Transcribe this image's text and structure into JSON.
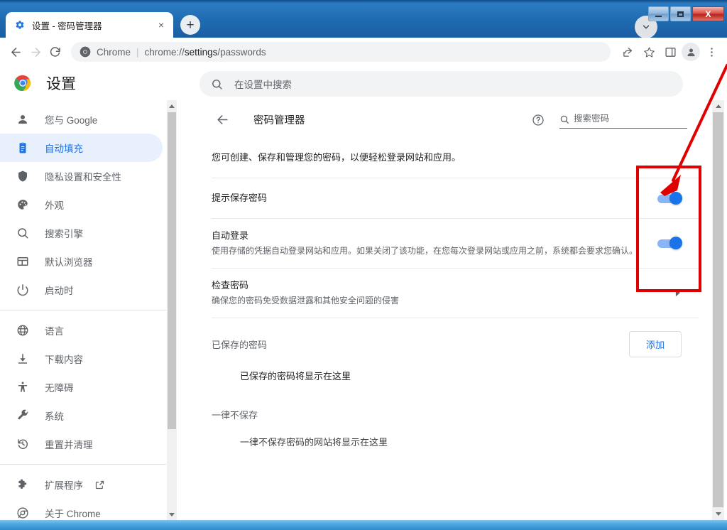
{
  "window": {
    "minimize_label": "minimize",
    "maximize_label": "maximize",
    "close_label": "X"
  },
  "tab": {
    "title": "设置 - 密码管理器",
    "close_label": "×",
    "new_tab_label": "+",
    "favicon": "gear-icon"
  },
  "toolbar": {
    "back_label": "←",
    "forward_label": "→",
    "reload_label": "⟳",
    "scheme_label": "Chrome",
    "separator": "|",
    "url_prefix": "chrome://",
    "url_bold": "settings",
    "url_suffix": "/passwords",
    "share_icon": "share-icon",
    "bookmark_icon": "star-icon",
    "side_panel_icon": "side-panel-icon",
    "profile_icon": "profile-avatar-icon",
    "menu_icon": "three-dot-menu-icon"
  },
  "settings_header": {
    "title": "设置",
    "logo": "chrome-logo-icon",
    "search_placeholder": "在设置中搜索",
    "search_icon": "search-icon"
  },
  "sidebar": {
    "items": [
      {
        "label": "您与 Google",
        "icon": "person-icon",
        "active": false
      },
      {
        "label": "自动填充",
        "icon": "clipboard-icon",
        "active": true
      },
      {
        "label": "隐私设置和安全性",
        "icon": "shield-icon",
        "active": false
      },
      {
        "label": "外观",
        "icon": "palette-icon",
        "active": false
      },
      {
        "label": "搜索引擎",
        "icon": "search-icon",
        "active": false
      },
      {
        "label": "默认浏览器",
        "icon": "browser-window-icon",
        "active": false
      },
      {
        "label": "启动时",
        "icon": "power-icon",
        "active": false
      }
    ],
    "items2": [
      {
        "label": "语言",
        "icon": "globe-icon"
      },
      {
        "label": "下载内容",
        "icon": "download-icon"
      },
      {
        "label": "无障碍",
        "icon": "accessibility-icon"
      },
      {
        "label": "系统",
        "icon": "wrench-icon"
      },
      {
        "label": "重置并清理",
        "icon": "history-restore-icon"
      }
    ],
    "items3": [
      {
        "label": "扩展程序",
        "icon": "puzzle-piece-icon",
        "external": true
      },
      {
        "label": "关于 Chrome",
        "icon": "chrome-logo-icon",
        "external": false
      }
    ]
  },
  "main": {
    "back_icon": "back-arrow-icon",
    "title": "密码管理器",
    "help_icon": "help-circle-icon",
    "search_icon": "search-icon",
    "search_placeholder": "搜索密码",
    "description": "您可创建、保存和管理您的密码，以便轻松登录网站和应用。",
    "rows": [
      {
        "title": "提示保存密码",
        "subtitle": "",
        "control": "toggle",
        "toggle_on": true
      },
      {
        "title": "自动登录",
        "subtitle": "使用存储的凭据自动登录网站和应用。如果关闭了该功能，在您每次登录网站或应用之前，系统都会要求您确认。",
        "control": "toggle",
        "toggle_on": true
      },
      {
        "title": "检查密码",
        "subtitle": "确保您的密码免受数据泄露和其他安全问题的侵害",
        "control": "chevron",
        "toggle_on": false
      }
    ],
    "saved_section": {
      "title": "已保存的密码",
      "add_button": "添加",
      "empty_text": "已保存的密码将显示在这里"
    },
    "never_section": {
      "title": "一律不保存",
      "empty_text": "一律不保存密码的网站将显示在这里"
    }
  },
  "annotation": {
    "rect_color": "#e00000",
    "arrow_color": "#e00000",
    "rect_name": "red-highlight-rectangle",
    "arrow_name": "red-pointer-arrow"
  },
  "colors": {
    "accent_blue": "#1a73e8",
    "toggle_track": "#8ab4f8",
    "active_nav_bg": "#e8f0fe",
    "red_annotation": "#e00000"
  }
}
